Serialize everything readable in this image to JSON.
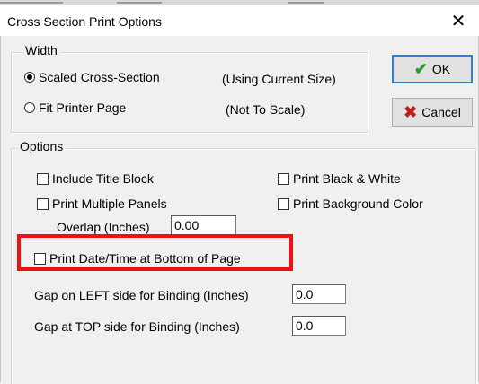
{
  "window": {
    "title": "Cross Section Print Options",
    "close_glyph": "✕"
  },
  "width_group": {
    "label": "Width",
    "options": [
      {
        "label": "Scaled Cross-Section",
        "note": "(Using Current Size)",
        "checked": true
      },
      {
        "label": "Fit Printer Page",
        "note": "(Not To Scale)",
        "checked": false
      }
    ]
  },
  "buttons": {
    "ok": {
      "label": "OK",
      "icon": "checkmark-icon",
      "icon_color": "#2e9a2e"
    },
    "cancel": {
      "label": "Cancel",
      "icon": "x-mark-icon",
      "icon_color": "#c0201a"
    }
  },
  "options_group": {
    "label": "Options",
    "include_title_block": "Include Title Block",
    "print_black_white": "Print Black & White",
    "print_multiple_panels": "Print Multiple Panels",
    "print_background_color": "Print Background Color",
    "overlap_label": "Overlap (Inches)",
    "overlap_value": "0.00",
    "print_date_time": "Print Date/Time at Bottom of Page",
    "gap_left_label": "Gap on LEFT side for Binding (Inches)",
    "gap_left_value": "0.0",
    "gap_top_label": "Gap at TOP side for Binding (Inches)",
    "gap_top_value": "0.0"
  },
  "highlight_color": "#ee1111"
}
